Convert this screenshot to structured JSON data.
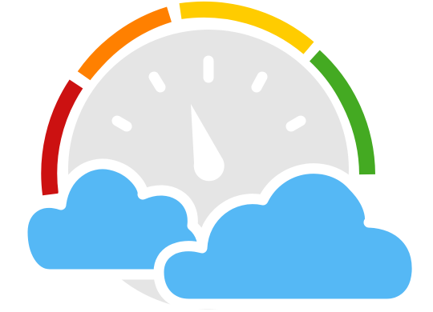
{
  "illustration": {
    "subject": "speedometer-gauge-with-clouds",
    "gauge": {
      "segment_colors": [
        "#cc1111",
        "#ff8000",
        "#ffcc00",
        "#44aa22"
      ],
      "dial_color": "#e5e5e5",
      "needle_color": "#ffffff",
      "tick_color": "#ffffff"
    },
    "clouds": {
      "fill_color": "#55b8f5",
      "outline_color": "#ffffff"
    }
  }
}
